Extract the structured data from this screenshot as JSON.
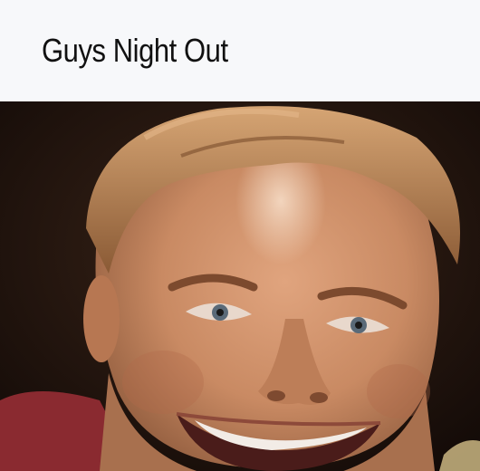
{
  "header": {
    "title": "Guys Night Out"
  },
  "photo": {
    "subject": "smiling-man-face"
  },
  "colors": {
    "header_bg": "#f7f8fa",
    "title_text": "#111111",
    "photo_bg": "#1a0f0a",
    "skin": "#c98a63",
    "hair": "#b07a4a",
    "shirt": "#8a2a30"
  }
}
